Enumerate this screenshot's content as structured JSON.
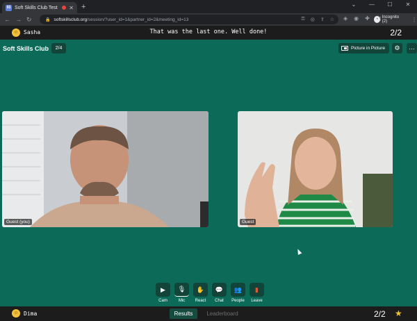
{
  "browser": {
    "tab_title": "Soft Skills Club Test",
    "favicon_text": "93",
    "url_host": "softskillsclub.org",
    "url_path": "/session/?user_id=1&partner_id=2&meeting_id=13",
    "incognito_label": "Incognito (2)"
  },
  "top_strip": {
    "user_name": "Sasha",
    "message": "That was the last one. Well done!",
    "count": "2/2"
  },
  "header": {
    "brand": "Soft Skills Club",
    "pager": "2/4",
    "pip_label": "Picture in Picture"
  },
  "videos": [
    {
      "label": "Guest (you)"
    },
    {
      "label": "Guest"
    }
  ],
  "controls": [
    {
      "label": "Cam",
      "icon": "camera-icon"
    },
    {
      "label": "Mic",
      "icon": "microphone-icon"
    },
    {
      "label": "React",
      "icon": "hand-wave-icon"
    },
    {
      "label": "Chat",
      "icon": "chat-icon"
    },
    {
      "label": "People",
      "icon": "people-icon"
    },
    {
      "label": "Leave",
      "icon": "door-icon"
    }
  ],
  "bottom_bar": {
    "user_name": "Dima",
    "tabs": [
      {
        "label": "Results",
        "active": true
      },
      {
        "label": "Leaderboard",
        "active": false
      }
    ],
    "count": "2/2"
  },
  "colors": {
    "stage_bg": "#0b6b58",
    "button_bg": "#13443a",
    "bar_bg": "#1c1c1c",
    "star": "#f4c430"
  }
}
